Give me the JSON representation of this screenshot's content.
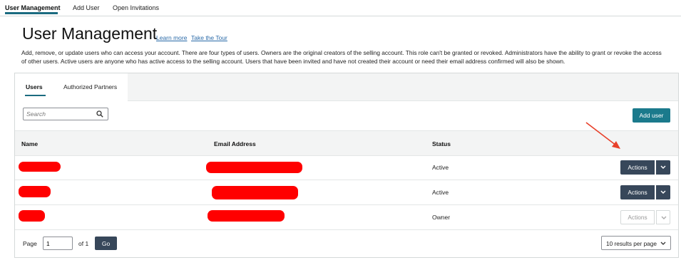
{
  "top_nav": {
    "tabs": [
      {
        "label": "User Management",
        "active": true
      },
      {
        "label": "Add User",
        "active": false
      },
      {
        "label": "Open Invitations",
        "active": false
      }
    ]
  },
  "header": {
    "title": "User Management",
    "learn_more": "Learn more",
    "take_tour": "Take the Tour",
    "description": "Add, remove, or update users who can access your account. There are four types of users. Owners are the original creators of the selling account. This role can't be granted or revoked. Administrators have the ability to grant or revoke the access of other users. Active users are anyone who has active access to the selling account. Users that have been invited and have not created their account or need their email address confirmed will also be shown."
  },
  "panel": {
    "tabs": [
      {
        "label": "Users",
        "active": true
      },
      {
        "label": "Authorized Partners",
        "active": false
      }
    ],
    "search": {
      "placeholder": "Search",
      "value": ""
    },
    "add_user_label": "Add user",
    "table": {
      "headers": [
        "Name",
        "Email Address",
        "Status"
      ],
      "rows": [
        {
          "name": "[redacted]",
          "email": "[redacted]",
          "status": "Active",
          "actions_label": "Actions",
          "actions_enabled": true
        },
        {
          "name": "[redacted]",
          "email": "[redacted]",
          "status": "Active",
          "actions_label": "Actions",
          "actions_enabled": true
        },
        {
          "name": "[redacted]",
          "email": "[redacted]",
          "status": "Owner",
          "actions_label": "Actions",
          "actions_enabled": false
        }
      ]
    },
    "pagination": {
      "page_label": "Page",
      "page_value": "1",
      "of_label": "of 1",
      "go_label": "Go",
      "per_page_label": "10 results per page"
    }
  },
  "colors": {
    "accent_teal": "#1b7a8c",
    "dark_button": "#37475a",
    "link_blue": "#2a6aa8",
    "redaction": "#ff0000",
    "annotation_arrow": "#e8402a"
  },
  "icons": {
    "search": "search-icon",
    "dropdown": "chevron-down-icon",
    "annotation": "red-arrow-icon"
  }
}
